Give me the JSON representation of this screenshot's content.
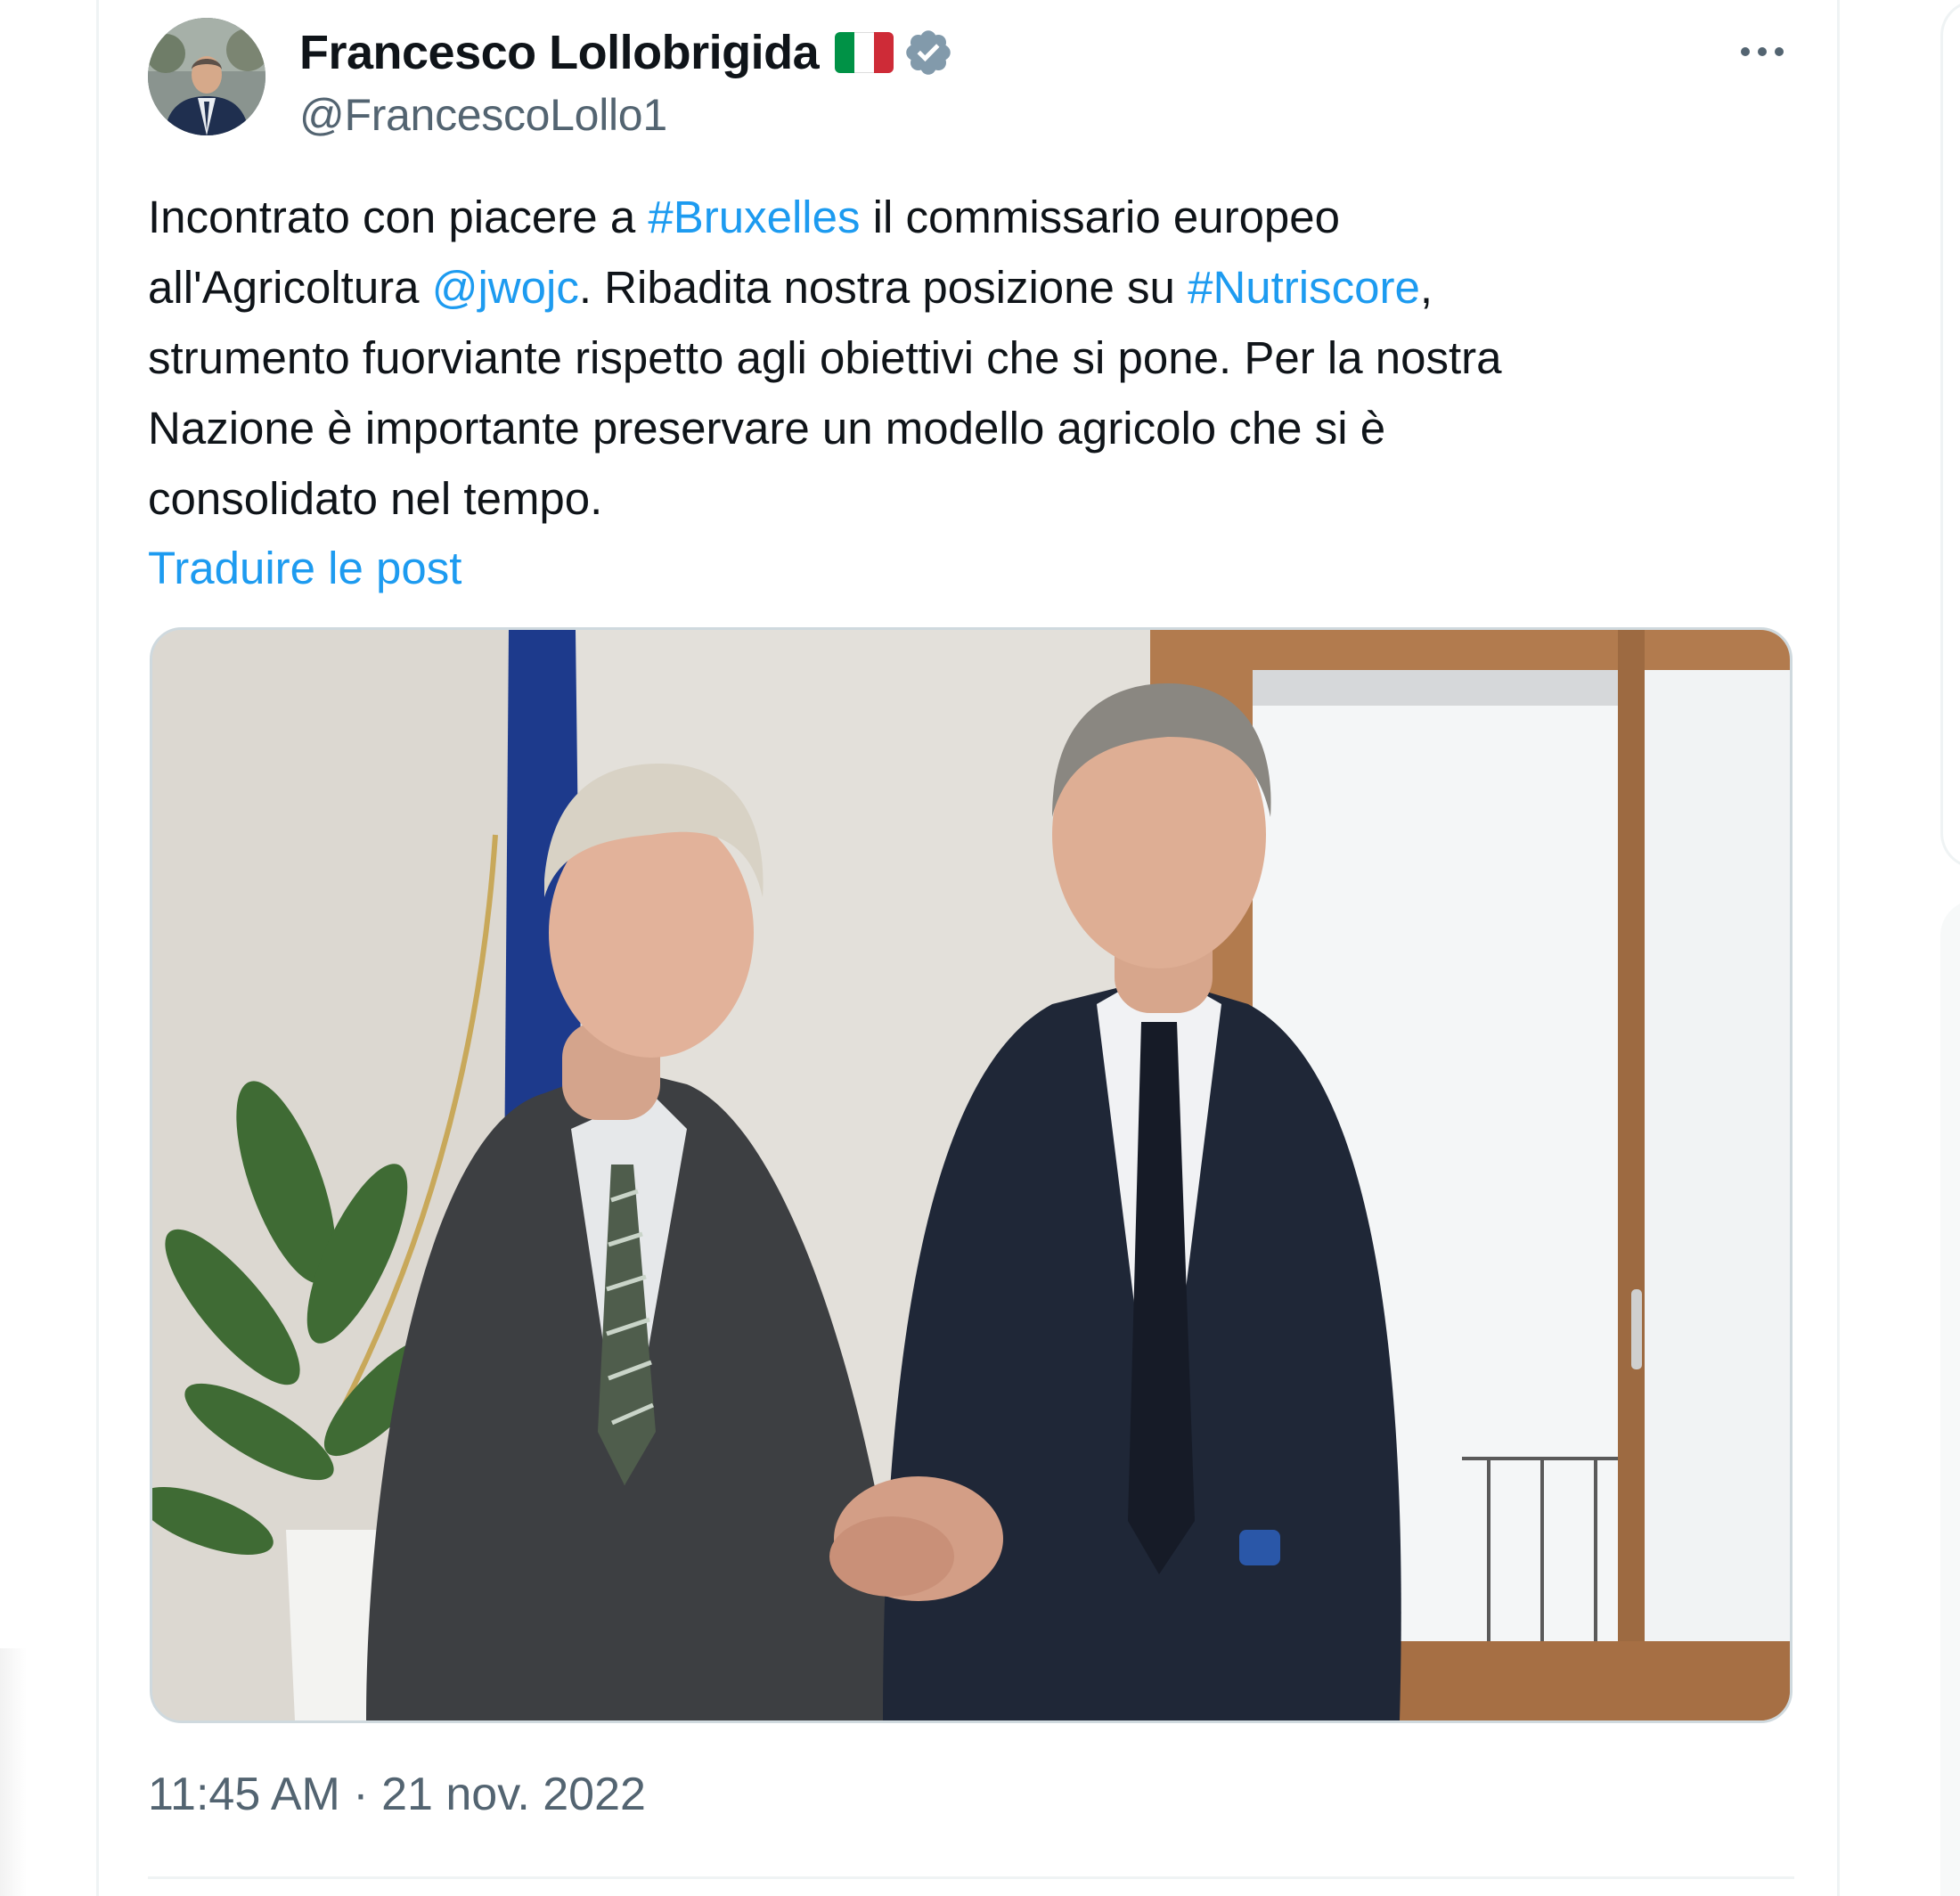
{
  "tweet": {
    "author": {
      "display_name": "Francesco Lollobrigida",
      "handle": "@FrancescoLollo1",
      "flag_icon": "italy-flag-icon",
      "verified_icon": "verified-badge-icon",
      "verified_color": "#829aab"
    },
    "more_icon": "more-horizontal-icon",
    "text": {
      "l1_a": "Incontrato con piacere a ",
      "hashtag_bruxelles": "#Bruxelles",
      "l1_b": " il commissario europeo",
      "l2_a": "all'Agricoltura ",
      "mention_jwojc": "@jwojc",
      "l2_b": ". Ribadita nostra posizione su ",
      "hashtag_nutriscore": "#Nutriscore",
      "l2_c": ",",
      "l3": "strumento fuorviante rispetto agli obiettivi che si pone. Per la nostra",
      "l4": "Nazione è importante preservare un modello agricolo che si è",
      "l5": "consolidato nel tempo."
    },
    "translate_label": "Traduire le post",
    "photo": {
      "description_icon": "photo-handshake-image"
    },
    "timestamp": {
      "time": "11:45 AM",
      "separator": " · ",
      "date": "21 nov. 2022"
    }
  },
  "colors": {
    "link": "#1d9bf0",
    "text": "#0f1419",
    "secondary": "#536471",
    "border": "#eff3f4",
    "flag_green": "#009246",
    "flag_white": "#ffffff",
    "flag_red": "#ce2b37"
  }
}
